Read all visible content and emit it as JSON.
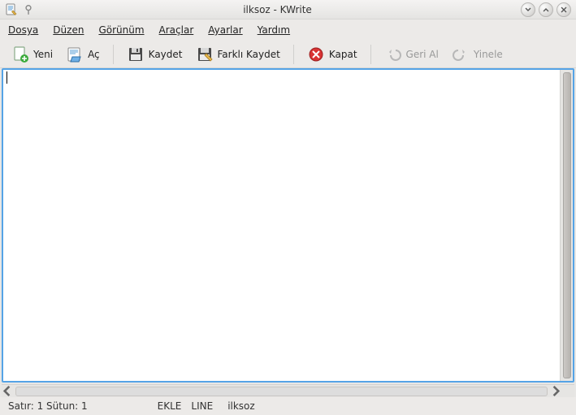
{
  "title": "ilksoz - KWrite",
  "menu": {
    "file": "Dosya",
    "edit": "Düzen",
    "view": "Görünüm",
    "tools": "Araçlar",
    "settings": "Ayarlar",
    "help": "Yardım"
  },
  "toolbar": {
    "new": "Yeni",
    "open": "Aç",
    "save": "Kaydet",
    "saveas": "Farklı Kaydet",
    "close": "Kapat",
    "undo": "Geri Al",
    "redo": "Yinele"
  },
  "status": {
    "linecol": "Satır: 1 Sütun: 1",
    "insert": "EKLE",
    "linemode": "LINE",
    "filename": "ilksoz"
  }
}
